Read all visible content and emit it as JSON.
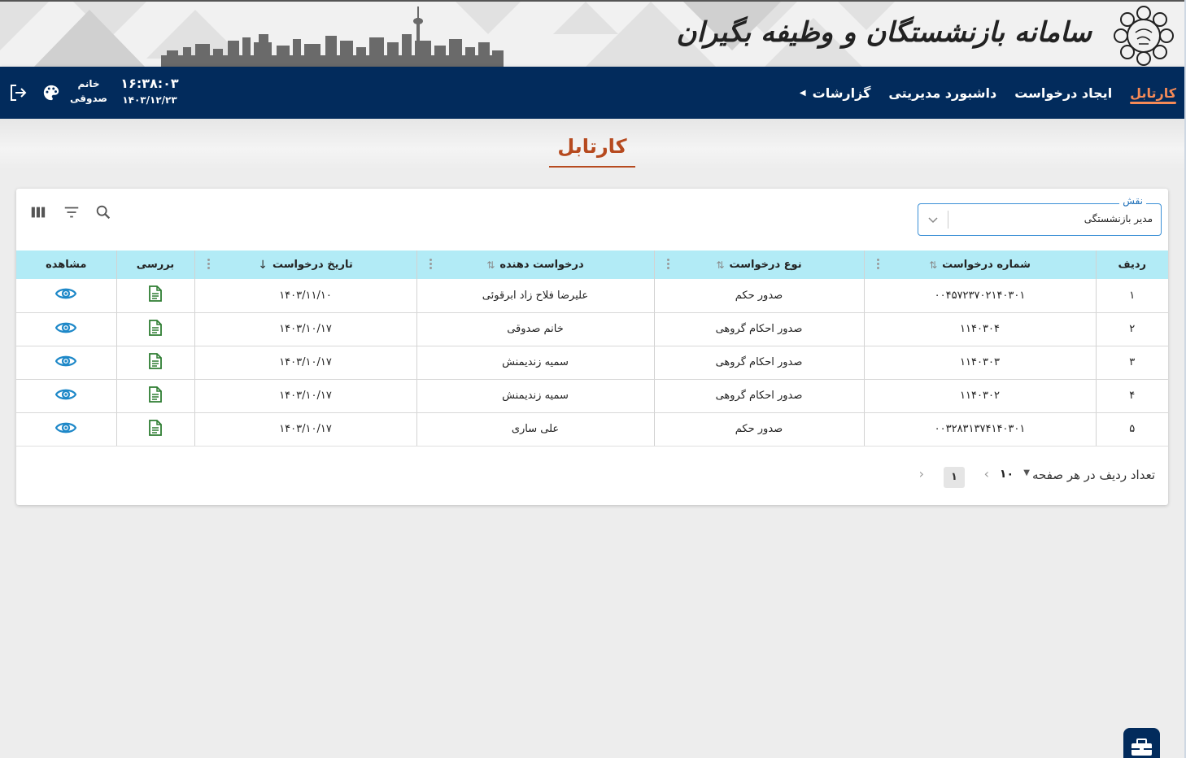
{
  "banner": {
    "title": "سامانه بازنشستگان و وظیفه بگیران"
  },
  "nav": {
    "items": [
      {
        "label": "کارتابل",
        "active": true
      },
      {
        "label": "ایجاد درخواست"
      },
      {
        "label": "داشبورد مدیریتی"
      },
      {
        "label": "گزارشات",
        "has_caret": true
      }
    ],
    "time": "۱۶:۳۸:۰۳",
    "date": "۱۴۰۳/۱۲/۲۳",
    "user_line1": "خانم",
    "user_line2": "صدوقی",
    "icons": [
      "palette-icon",
      "logout-icon"
    ]
  },
  "page": {
    "title": "کارتابل"
  },
  "filter": {
    "role_label": "نقش",
    "role_value": "مدیر بازنشستگی"
  },
  "table": {
    "headers": {
      "row": "ردیف",
      "number": "شماره درخواست",
      "type": "نوع درخواست",
      "requester": "درخواست دهنده",
      "date": "تاریخ درخواست",
      "review": "بررسی",
      "view": "مشاهده"
    },
    "rows": [
      {
        "row": "۱",
        "number": "۰۰۴۵۷۲۳۷۰۲۱۴۰۳۰۱",
        "type": "صدور حکم",
        "requester": "علیرضا فلاح زاد ابرقوئی",
        "date": "۱۴۰۳/۱۱/۱۰"
      },
      {
        "row": "۲",
        "number": "۱۱۴۰۳۰۴",
        "type": "صدور احکام گروهی",
        "requester": "خانم صدوقی",
        "date": "۱۴۰۳/۱۰/۱۷"
      },
      {
        "row": "۳",
        "number": "۱۱۴۰۳۰۳",
        "type": "صدور احکام گروهی",
        "requester": "سمیه زندیمنش",
        "date": "۱۴۰۳/۱۰/۱۷"
      },
      {
        "row": "۴",
        "number": "۱۱۴۰۳۰۲",
        "type": "صدور احکام گروهی",
        "requester": "سمیه زندیمنش",
        "date": "۱۴۰۳/۱۰/۱۷"
      },
      {
        "row": "۵",
        "number": "۰۰۳۲۸۳۱۳۷۴۱۴۰۳۰۱",
        "type": "صدور حکم",
        "requester": "علی ساری",
        "date": "۱۴۰۳/۱۰/۱۷"
      }
    ]
  },
  "pagination": {
    "rows_per_page_label": "تعداد ردیف در هر صفحه",
    "rows_per_page": "۱۰",
    "current_page": "۱"
  },
  "colors": {
    "navbar": "#022b5c",
    "active_nav": "#f58a57",
    "title": "#b64a1f",
    "header_row": "#b2ebf6",
    "view_icon": "#1e88c8",
    "review_icon": "#2e7d32"
  }
}
